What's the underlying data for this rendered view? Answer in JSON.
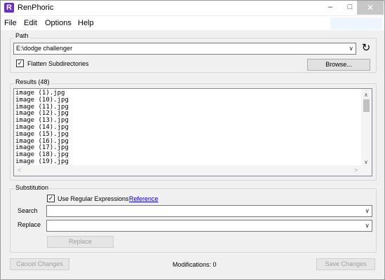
{
  "window": {
    "title": "RenPhoric"
  },
  "menu": {
    "items": [
      "File",
      "Edit",
      "Options",
      "Help"
    ]
  },
  "path_group": {
    "label": "Path",
    "value": "E:\\dodge challenger",
    "flatten_label": "Flatten Subdirectories",
    "flatten_checked": true,
    "browse_label": "Browse..."
  },
  "results": {
    "label": "Results (48)",
    "items": [
      "image (1).jpg",
      "image (10).jpg",
      "image (11).jpg",
      "image (12).jpg",
      "image (13).jpg",
      "image (14).jpg",
      "image (15).jpg",
      "image (16).jpg",
      "image (17).jpg",
      "image (18).jpg",
      "image (19).jpg"
    ]
  },
  "substitution": {
    "label": "Substitution",
    "use_regex_label": "Use Regular Expressions",
    "use_regex_checked": true,
    "reference_link": "Reference",
    "search_label": "Search",
    "search_value": "",
    "replace_label": "Replace",
    "replace_value": "",
    "replace_button": "Replace"
  },
  "footer": {
    "cancel_label": "Cancel Changes",
    "modifications": "Modifications: 0",
    "save_label": "Save Changes"
  },
  "colors": {
    "accent_icon": "#6b2fbf",
    "link": "#0000ee",
    "close_button": "#c7c7c7"
  }
}
